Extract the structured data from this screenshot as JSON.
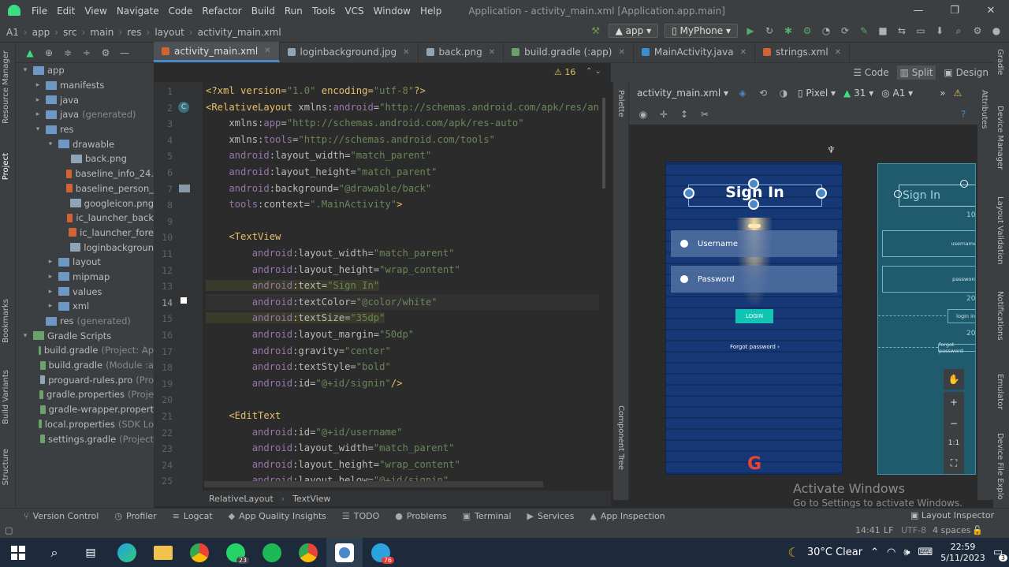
{
  "menu": [
    "File",
    "Edit",
    "View",
    "Navigate",
    "Code",
    "Refactor",
    "Build",
    "Run",
    "Tools",
    "VCS",
    "Window",
    "Help"
  ],
  "window_title": "Application - activity_main.xml [Application.app.main]",
  "breadcrumbs": [
    "A1",
    "app",
    "src",
    "main",
    "res",
    "layout",
    "activity_main.xml"
  ],
  "run_config": "app",
  "device": "MyPhone",
  "file_tabs": [
    {
      "label": "activity_main.xml",
      "active": true
    },
    {
      "label": "loginbackground.jpg"
    },
    {
      "label": "back.png"
    },
    {
      "label": "build.gradle (:app)"
    },
    {
      "label": "MainActivity.java"
    },
    {
      "label": "strings.xml"
    }
  ],
  "view_modes": {
    "code": "Code",
    "split": "Split",
    "design": "Design"
  },
  "project_tree": [
    {
      "indent": 0,
      "arrow": "▾",
      "icon": "folder",
      "label": "app"
    },
    {
      "indent": 1,
      "arrow": "▸",
      "icon": "folder",
      "label": "manifests"
    },
    {
      "indent": 1,
      "arrow": "▸",
      "icon": "folder",
      "label": "java"
    },
    {
      "indent": 1,
      "arrow": "▸",
      "icon": "folder",
      "label": "java",
      "ext": "(generated)"
    },
    {
      "indent": 1,
      "arrow": "▾",
      "icon": "folder",
      "label": "res"
    },
    {
      "indent": 2,
      "arrow": "▾",
      "icon": "folder",
      "label": "drawable"
    },
    {
      "indent": 3,
      "arrow": "",
      "icon": "img",
      "label": "back.png"
    },
    {
      "indent": 3,
      "arrow": "",
      "icon": "xml",
      "label": "baseline_info_24."
    },
    {
      "indent": 3,
      "arrow": "",
      "icon": "xml",
      "label": "baseline_person_"
    },
    {
      "indent": 3,
      "arrow": "",
      "icon": "img",
      "label": "googleicon.png"
    },
    {
      "indent": 3,
      "arrow": "",
      "icon": "xml",
      "label": "ic_launcher_back"
    },
    {
      "indent": 3,
      "arrow": "",
      "icon": "xml",
      "label": "ic_launcher_fore"
    },
    {
      "indent": 3,
      "arrow": "",
      "icon": "img",
      "label": "loginbackgroun"
    },
    {
      "indent": 2,
      "arrow": "▸",
      "icon": "folder",
      "label": "layout"
    },
    {
      "indent": 2,
      "arrow": "▸",
      "icon": "folder",
      "label": "mipmap"
    },
    {
      "indent": 2,
      "arrow": "▸",
      "icon": "folder",
      "label": "values"
    },
    {
      "indent": 2,
      "arrow": "▸",
      "icon": "folder",
      "label": "xml"
    },
    {
      "indent": 1,
      "arrow": "",
      "icon": "folder",
      "label": "res",
      "ext": "(generated)"
    },
    {
      "indent": 0,
      "arrow": "▾",
      "icon": "gradle",
      "label": "Gradle Scripts"
    },
    {
      "indent": 1,
      "arrow": "",
      "icon": "gradle",
      "label": "build.gradle",
      "ext": "(Project: Ap"
    },
    {
      "indent": 1,
      "arrow": "",
      "icon": "gradle",
      "label": "build.gradle",
      "ext": "(Module :a"
    },
    {
      "indent": 1,
      "arrow": "",
      "icon": "img",
      "label": "proguard-rules.pro",
      "ext": "(Pro"
    },
    {
      "indent": 1,
      "arrow": "",
      "icon": "gradle",
      "label": "gradle.properties",
      "ext": "(Proje"
    },
    {
      "indent": 1,
      "arrow": "",
      "icon": "gradle",
      "label": "gradle-wrapper.propert"
    },
    {
      "indent": 1,
      "arrow": "",
      "icon": "gradle",
      "label": "local.properties",
      "ext": "(SDK Lo"
    },
    {
      "indent": 1,
      "arrow": "",
      "icon": "gradle",
      "label": "settings.gradle",
      "ext": "(Project"
    }
  ],
  "code_lines": [
    [
      {
        "c": "tg",
        "t": "<?xml version="
      },
      {
        "c": "st",
        "t": "\"1.0\""
      },
      {
        "c": "tg",
        "t": " encoding="
      },
      {
        "c": "st",
        "t": "\"utf-8\""
      },
      {
        "c": "tg",
        "t": "?>"
      }
    ],
    [
      {
        "c": "tg",
        "t": "<RelativeLayout "
      },
      {
        "c": "at",
        "t": "xmlns:"
      },
      {
        "c": "an",
        "t": "android"
      },
      {
        "c": "at",
        "t": "="
      },
      {
        "c": "st",
        "t": "\"http://schemas.android.com/apk/res/an"
      }
    ],
    [
      {
        "c": "at",
        "t": "    xmlns:"
      },
      {
        "c": "an",
        "t": "app"
      },
      {
        "c": "at",
        "t": "="
      },
      {
        "c": "st",
        "t": "\"http://schemas.android.com/apk/res-auto\""
      }
    ],
    [
      {
        "c": "at",
        "t": "    xmlns:"
      },
      {
        "c": "an",
        "t": "tools"
      },
      {
        "c": "at",
        "t": "="
      },
      {
        "c": "st",
        "t": "\"http://schemas.android.com/tools\""
      }
    ],
    [
      {
        "c": "an",
        "t": "    android"
      },
      {
        "c": "at",
        "t": ":layout_width="
      },
      {
        "c": "st",
        "t": "\"match_parent\""
      }
    ],
    [
      {
        "c": "an",
        "t": "    android"
      },
      {
        "c": "at",
        "t": ":layout_height="
      },
      {
        "c": "st",
        "t": "\"match_parent\""
      }
    ],
    [
      {
        "c": "an",
        "t": "    android"
      },
      {
        "c": "at",
        "t": ":background="
      },
      {
        "c": "st",
        "t": "\"@drawable/back\""
      }
    ],
    [
      {
        "c": "an",
        "t": "    tools"
      },
      {
        "c": "at",
        "t": ":context="
      },
      {
        "c": "st",
        "t": "\".MainActivity\""
      },
      {
        "c": "tg",
        "t": ">"
      }
    ],
    [],
    [
      {
        "c": "tg",
        "t": "    <TextView"
      }
    ],
    [
      {
        "c": "an",
        "t": "        android"
      },
      {
        "c": "at",
        "t": ":layout_width="
      },
      {
        "c": "st",
        "t": "\"match_parent\""
      }
    ],
    [
      {
        "c": "an",
        "t": "        android"
      },
      {
        "c": "at",
        "t": ":layout_height="
      },
      {
        "c": "st",
        "t": "\"wrap_content\""
      }
    ],
    [
      {
        "c": "an hl",
        "t": "        android"
      },
      {
        "c": "at hl",
        "t": ":text="
      },
      {
        "c": "st hl",
        "t": "\"Sign In\""
      }
    ],
    [
      {
        "c": "an",
        "t": "        android"
      },
      {
        "c": "at",
        "t": ":textColor="
      },
      {
        "c": "st",
        "t": "\"@color/white\""
      }
    ],
    [
      {
        "c": "an hl",
        "t": "        android"
      },
      {
        "c": "at hl",
        "t": ":textSize="
      },
      {
        "c": "st hl",
        "t": "\"35dp\""
      }
    ],
    [
      {
        "c": "an",
        "t": "        android"
      },
      {
        "c": "at",
        "t": ":layout_margin="
      },
      {
        "c": "st",
        "t": "\"50dp\""
      }
    ],
    [
      {
        "c": "an",
        "t": "        android"
      },
      {
        "c": "at",
        "t": ":gravity="
      },
      {
        "c": "st",
        "t": "\"center\""
      }
    ],
    [
      {
        "c": "an",
        "t": "        android"
      },
      {
        "c": "at",
        "t": ":textStyle="
      },
      {
        "c": "st",
        "t": "\"bold\""
      }
    ],
    [
      {
        "c": "an",
        "t": "        android"
      },
      {
        "c": "at",
        "t": ":id="
      },
      {
        "c": "st",
        "t": "\"@+id/signin\""
      },
      {
        "c": "tg",
        "t": "/>"
      }
    ],
    [],
    [
      {
        "c": "tg",
        "t": "    <EditText"
      }
    ],
    [
      {
        "c": "an",
        "t": "        android"
      },
      {
        "c": "at",
        "t": ":id="
      },
      {
        "c": "st",
        "t": "\"@+id/username\""
      }
    ],
    [
      {
        "c": "an",
        "t": "        android"
      },
      {
        "c": "at",
        "t": ":layout_width="
      },
      {
        "c": "st",
        "t": "\"match_parent\""
      }
    ],
    [
      {
        "c": "an",
        "t": "        android"
      },
      {
        "c": "at",
        "t": ":layout_height="
      },
      {
        "c": "st",
        "t": "\"wrap_content\""
      }
    ],
    [
      {
        "c": "an",
        "t": "        android"
      },
      {
        "c": "at",
        "t": ":layout_below="
      },
      {
        "c": "st",
        "t": "\"@+id/signin\""
      }
    ]
  ],
  "warnings": "16",
  "editor_breadcrumb": [
    "RelativeLayout",
    "TextView"
  ],
  "design_toolbar": {
    "file": "activity_main.xml",
    "pixel": "Pixel",
    "api": "31",
    "locale": "A1"
  },
  "preview": {
    "title": "Sign In",
    "username": "Username",
    "password": "Password",
    "login": "LOGIN",
    "forgot": "Forgot password",
    "google": "G"
  },
  "blueprint": {
    "title": "Sign In",
    "username": "username",
    "password": "password",
    "login": "login in",
    "forgot": "forgot password",
    "margin1": "10",
    "margin2": "20",
    "margin3": "20"
  },
  "zoom": [
    "+",
    "−",
    "1:1"
  ],
  "side_left": [
    "Resource Manager",
    "Project",
    "Bookmarks",
    "Build Variants",
    "Structure"
  ],
  "side_right": [
    "Gradle",
    "Device Manager",
    "Layout Validation",
    "Notifications",
    "Emulator",
    "Device File Explo"
  ],
  "side_design": [
    "Attributes"
  ],
  "palette_tabs": [
    "Palette",
    "Component Tree"
  ],
  "bottom_tools": [
    {
      "icon": "⑂",
      "label": "Version Control"
    },
    {
      "icon": "◷",
      "label": "Profiler"
    },
    {
      "icon": "≡",
      "label": "Logcat"
    },
    {
      "icon": "◆",
      "label": "App Quality Insights"
    },
    {
      "icon": "☰",
      "label": "TODO"
    },
    {
      "icon": "●",
      "label": "Problems"
    },
    {
      "icon": "▣",
      "label": "Terminal"
    },
    {
      "icon": "▶",
      "label": "Services"
    },
    {
      "icon": "▲",
      "label": "App Inspection"
    }
  ],
  "layout_inspector": "Layout Inspector",
  "status": {
    "pos": "14:41",
    "sep": "LF",
    "enc": "UTF-8",
    "indent": "4 spaces"
  },
  "watermark": {
    "title": "Activate Windows",
    "sub": "Go to Settings to activate Windows."
  },
  "taskbar": {
    "temp": "30°C",
    "weather": "Clear",
    "time": "22:59",
    "date": "5/11/2023",
    "whatsapp_badge": "23",
    "telegram_badge": "76",
    "notif": "3"
  }
}
